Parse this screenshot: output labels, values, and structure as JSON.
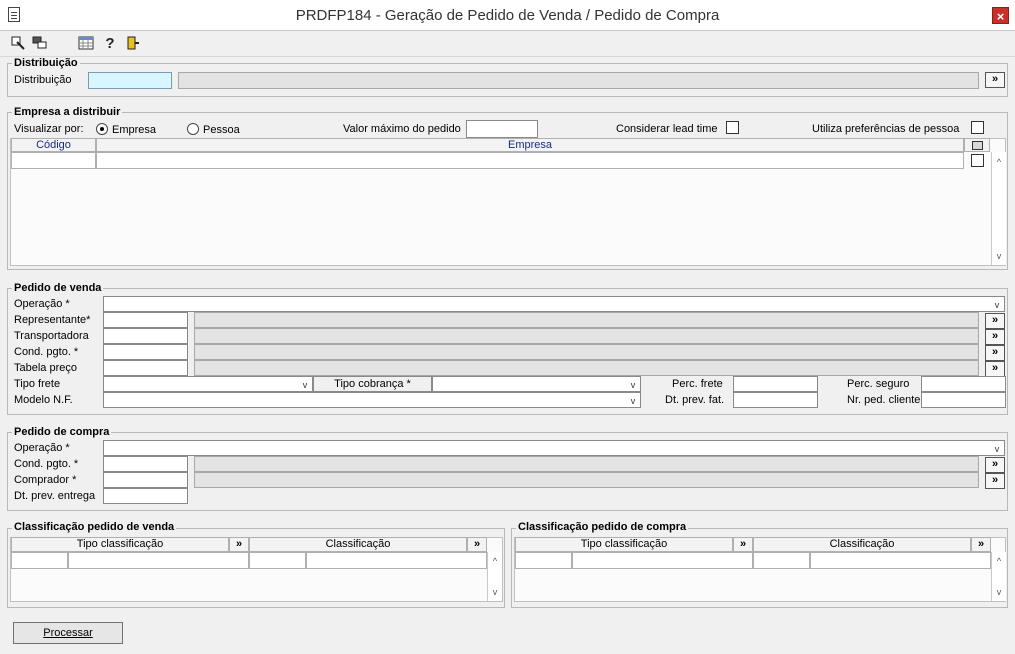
{
  "window": {
    "title": "PRDFP184 - Geração de Pedido de Venda / Pedido de Compra",
    "close_label": "×"
  },
  "toolbar": {
    "icons": [
      "navigate-icon",
      "multi-window-icon",
      "grid-icon",
      "help-icon",
      "exit-icon"
    ],
    "help_glyph": "?"
  },
  "distribuicao": {
    "group_title": "Distribuição",
    "label": "Distribuição",
    "more": "»"
  },
  "empresa": {
    "group_title": "Empresa a distribuir",
    "visualizar_label": "Visualizar por:",
    "radio_empresa": "Empresa",
    "radio_pessoa": "Pessoa",
    "selected": "Empresa",
    "valor_maximo_label": "Valor máximo do pedido",
    "lead_time_label": "Considerar lead time",
    "preferencias_label": "Utiliza preferências de pessoa",
    "columns": [
      "Código",
      "Empresa"
    ]
  },
  "pedido_venda": {
    "group_title": "Pedido de venda",
    "operacao_label": "Operação *",
    "representante_label": "Representante*",
    "transportadora_label": "Transportadora",
    "cond_pgto_label": "Cond. pgto. *",
    "tabela_preco_label": "Tabela preço",
    "tipo_frete_label": "Tipo frete",
    "tipo_cobranca_label": "Tipo cobrança *",
    "perc_frete_label": "Perc. frete",
    "perc_seguro_label": "Perc. seguro",
    "modelo_nf_label": "Modelo N.F.",
    "dt_prev_fat_label": "Dt. prev. fat.",
    "nr_ped_cliente_label": "Nr. ped. cliente",
    "more": "»"
  },
  "pedido_compra": {
    "group_title": "Pedido de compra",
    "operacao_label": "Operação *",
    "cond_pgto_label": "Cond. pgto. *",
    "comprador_label": "Comprador *",
    "dt_prev_entrega_label": "Dt. prev. entrega",
    "more": "»"
  },
  "class_venda": {
    "group_title": "Classificação pedido de venda",
    "col_tipo": "Tipo classificação",
    "col_class": "Classificação",
    "more": "»"
  },
  "class_compra": {
    "group_title": "Classificação pedido de compra",
    "col_tipo": "Tipo classificação",
    "col_class": "Classificação",
    "more": "»"
  },
  "actions": {
    "processar": "Processar"
  }
}
